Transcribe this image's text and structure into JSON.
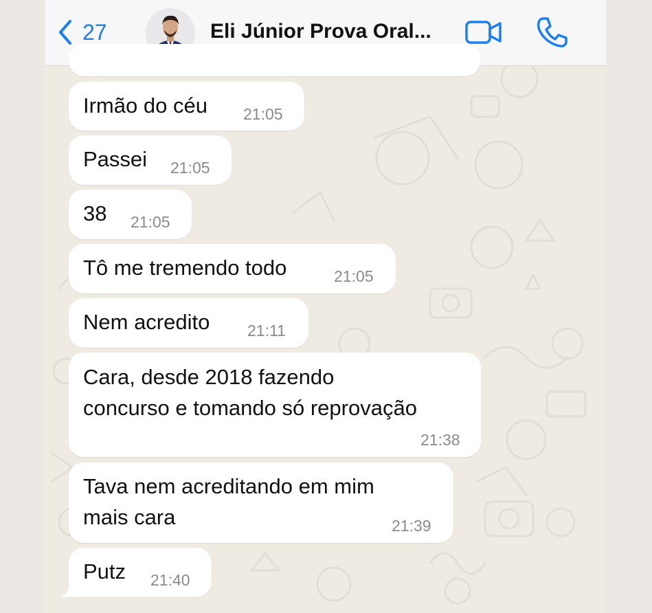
{
  "header": {
    "back_count": "27",
    "contact_name": "Eli Júnior Prova Oral...",
    "icons": {
      "back": "chevron-left-icon",
      "video": "video-camera-icon",
      "call": "phone-icon"
    },
    "accent_color": "#1d7ef0"
  },
  "messages": [
    {
      "text": "Irmão do céu",
      "time": "21:05"
    },
    {
      "text": "Passei",
      "time": "21:05"
    },
    {
      "text": "38",
      "time": "21:05"
    },
    {
      "text": "Tô me tremendo todo",
      "time": "21:05"
    },
    {
      "text": "Nem acredito",
      "time": "21:11"
    },
    {
      "line1": "Cara, desde 2018 fazendo",
      "line2": "concurso e tomando só reprovação",
      "time": "21:38"
    },
    {
      "line1": "Tava nem acreditando em mim",
      "line2": "mais cara",
      "time": "21:39"
    },
    {
      "text": "Putz",
      "time": "21:40"
    }
  ],
  "colors": {
    "bubble": "#ffffff",
    "chat_background": "#efeae2",
    "timestamp": "#8a8a8a"
  }
}
